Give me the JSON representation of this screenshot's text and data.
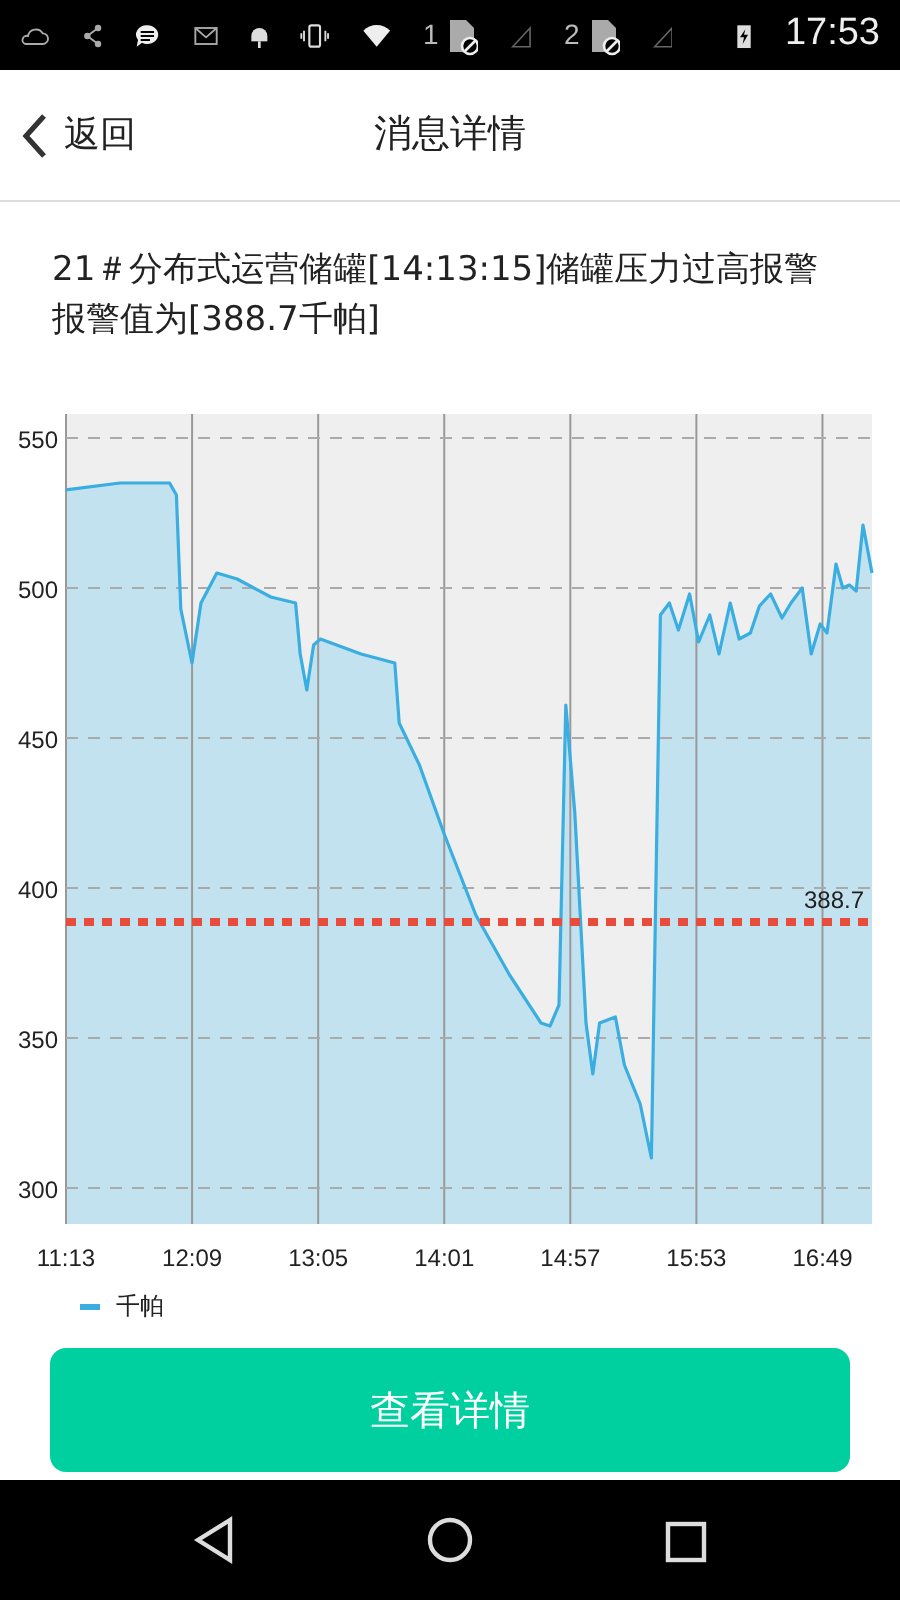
{
  "status_bar": {
    "sim_slots": [
      "1",
      "2"
    ],
    "time": "17:53"
  },
  "header": {
    "back_label": "返回",
    "title": "消息详情"
  },
  "message": "21＃分布式运营储罐[14:13:15]储罐压力过高报警报警值为[388.7千帕]",
  "chart": {
    "chart_data": {
      "type": "area",
      "xlim": [
        673,
        1031
      ],
      "ylim": [
        288,
        558
      ],
      "xticks": [
        {
          "value": 673,
          "label": "11:13"
        },
        {
          "value": 729,
          "label": "12:09"
        },
        {
          "value": 785,
          "label": "13:05"
        },
        {
          "value": 841,
          "label": "14:01"
        },
        {
          "value": 897,
          "label": "14:57"
        },
        {
          "value": 953,
          "label": "15:53"
        },
        {
          "value": 1009,
          "label": "16:49"
        }
      ],
      "yticks": [
        300,
        350,
        400,
        450,
        500,
        550
      ],
      "grid": true,
      "x": [
        673,
        697,
        719,
        722,
        724,
        729,
        733,
        740,
        749,
        764,
        775,
        777,
        780,
        783,
        786,
        804,
        819,
        821,
        830,
        841,
        855,
        870,
        884,
        888,
        892,
        895,
        899,
        904,
        907,
        910,
        917,
        921,
        928,
        933,
        937,
        941,
        945,
        950,
        954,
        959,
        963,
        968,
        972,
        977,
        981,
        986,
        991,
        995,
        1000,
        1004,
        1008,
        1011,
        1015,
        1018,
        1021,
        1024,
        1027,
        1031
      ],
      "series": [
        {
          "name": "千帕",
          "color": "#3aaee0",
          "values": [
            532.7,
            535,
            535,
            531,
            493,
            475,
            495,
            505,
            503,
            497,
            495,
            478,
            466,
            481,
            483,
            478,
            475,
            455,
            441,
            418,
            391,
            371,
            355,
            354,
            361,
            461,
            425,
            355,
            338,
            355,
            357,
            341,
            328,
            310,
            491,
            495,
            486,
            498,
            482,
            491,
            478,
            495,
            483,
            485,
            494,
            498,
            490,
            495,
            500,
            478,
            488,
            485,
            508,
            500,
            501,
            499,
            521,
            505
          ]
        }
      ],
      "ref_lines": [
        {
          "axis": "y",
          "value": 388.7,
          "label": "388.7",
          "color": "#e74c3c"
        }
      ]
    }
  },
  "action_button": "查看详情"
}
